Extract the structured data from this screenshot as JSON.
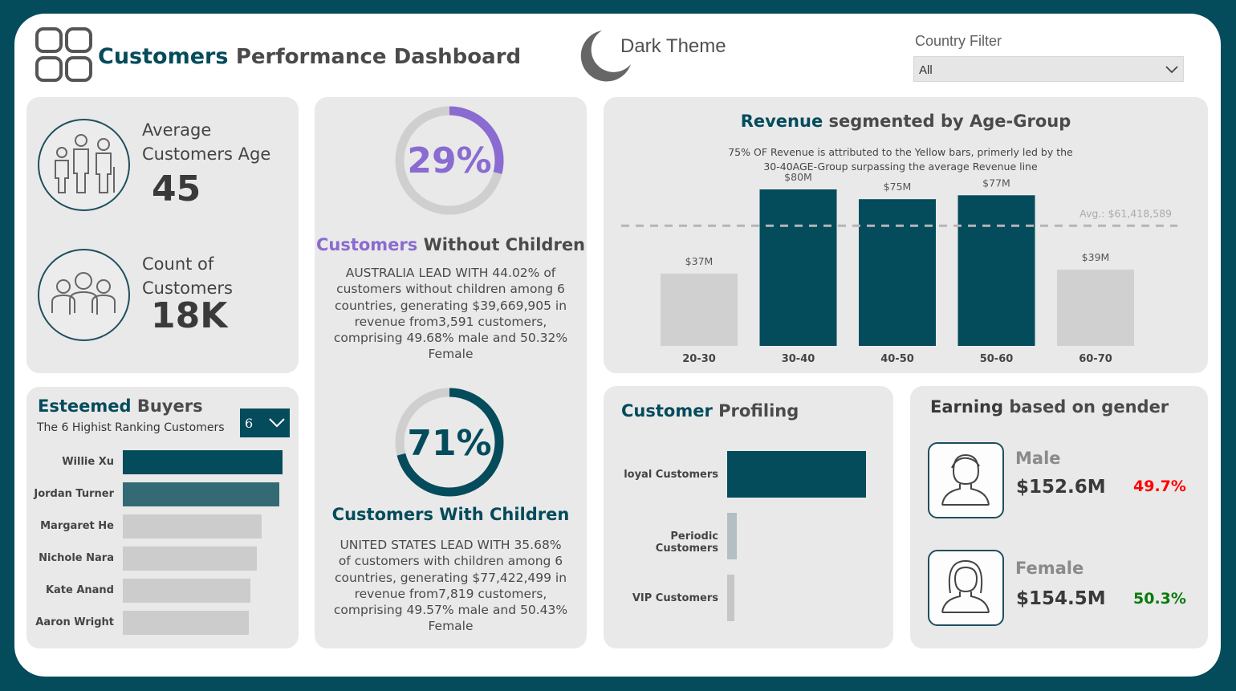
{
  "header": {
    "title_bold": "Customers",
    "title_rest": "Performance Dashboard",
    "theme_label": "Dark Theme",
    "filter_label": "Country Filter",
    "filter_value": "All"
  },
  "kpis": {
    "age_label_1": "Average",
    "age_label_2": "Customers Age",
    "age_value": "45",
    "count_label_1": "Count of",
    "count_label_2": "Customers",
    "count_value": "18K"
  },
  "without_children": {
    "percent": "29%",
    "percent_value": 0.29,
    "title_accent": "Customers",
    "title_rest": "Without Children",
    "lines": [
      "AUSTRALIA LEAD WITH 44.02% of",
      "customers without children among 6",
      "countries, generating  $39,669,905 in",
      "revenue from3,591 customers,",
      "comprising 49.68% male and 50.32%",
      "Female"
    ]
  },
  "with_children": {
    "percent": "71%",
    "percent_value": 0.71,
    "title_accent": "Customers",
    "title_rest": "With Children",
    "lines": [
      "UNITED STATES LEAD WITH 35.68%",
      "of customers with children among 6",
      "countries, generating  $77,422,499 in",
      "revenue from7,819 customers,",
      "comprising 49.57% male and 50.43%",
      "Female"
    ]
  },
  "revenue_chart": {
    "title_accent": "Revenue",
    "title_rest": "segmented by Age-Group",
    "subtitle_1": "75% OF Revenue is attributed to the Yellow bars, primerly led by the",
    "subtitle_2": "30-40AGE-Group surpassing the average Revenue line",
    "avg_label": "Avg.: $61,418,589",
    "colors": {
      "highlight": "#044b5b",
      "normal": "#d0d0d0",
      "avg_line": "#b5b5b5"
    }
  },
  "chart_data": [
    {
      "type": "bar",
      "title": "Revenue segmented by Age-Group",
      "categories": [
        "20-30",
        "30-40",
        "40-50",
        "50-60",
        "60-70"
      ],
      "values": [
        37,
        80,
        75,
        77,
        39
      ],
      "value_labels": [
        "$37M",
        "$80M",
        "$75M",
        "$77M",
        "$39M"
      ],
      "highlight": [
        false,
        true,
        true,
        true,
        false
      ],
      "average": 61.418589,
      "ylim": [
        0,
        80
      ],
      "unit": "$M"
    },
    {
      "type": "bar",
      "orientation": "horizontal",
      "title": "Esteemed Buyers",
      "categories": [
        "Willie Xu",
        "Jordan Turner",
        "Margaret He",
        "Nichole Nara",
        "Kate Anand",
        "Aaron Wright"
      ],
      "values": [
        100,
        98,
        87,
        84,
        80,
        79
      ],
      "unit": "relative"
    },
    {
      "type": "bar",
      "orientation": "horizontal",
      "title": "Customer Profiling",
      "categories": [
        "loyal Customers",
        "Periodic Customers",
        "VIP Customers"
      ],
      "values": [
        100,
        7,
        5
      ],
      "unit": "relative"
    }
  ],
  "esteemed": {
    "title_accent": "Esteemed",
    "title_rest": "Buyers",
    "subtitle": "The 6 Highist Ranking Customers",
    "selector_value": "6",
    "colors": [
      "#044b5b",
      "#336a74",
      "#cccccc",
      "#cccccc",
      "#cccccc",
      "#cccccc"
    ]
  },
  "profiling": {
    "title_accent": "Customer",
    "title_rest": "Profiling",
    "colors": [
      "#044b5b",
      "#b3bfc2",
      "#c6c6c6"
    ]
  },
  "gender": {
    "title_accent": "Earning",
    "title_rest": "based on gender",
    "male_label": "Male",
    "male_value": "$152.6M",
    "male_pct": "49.7%",
    "female_label": "Female",
    "female_value": "$154.5M",
    "female_pct": "50.3%",
    "male_color": "#ff0000",
    "female_color": "#0a7a0a"
  }
}
